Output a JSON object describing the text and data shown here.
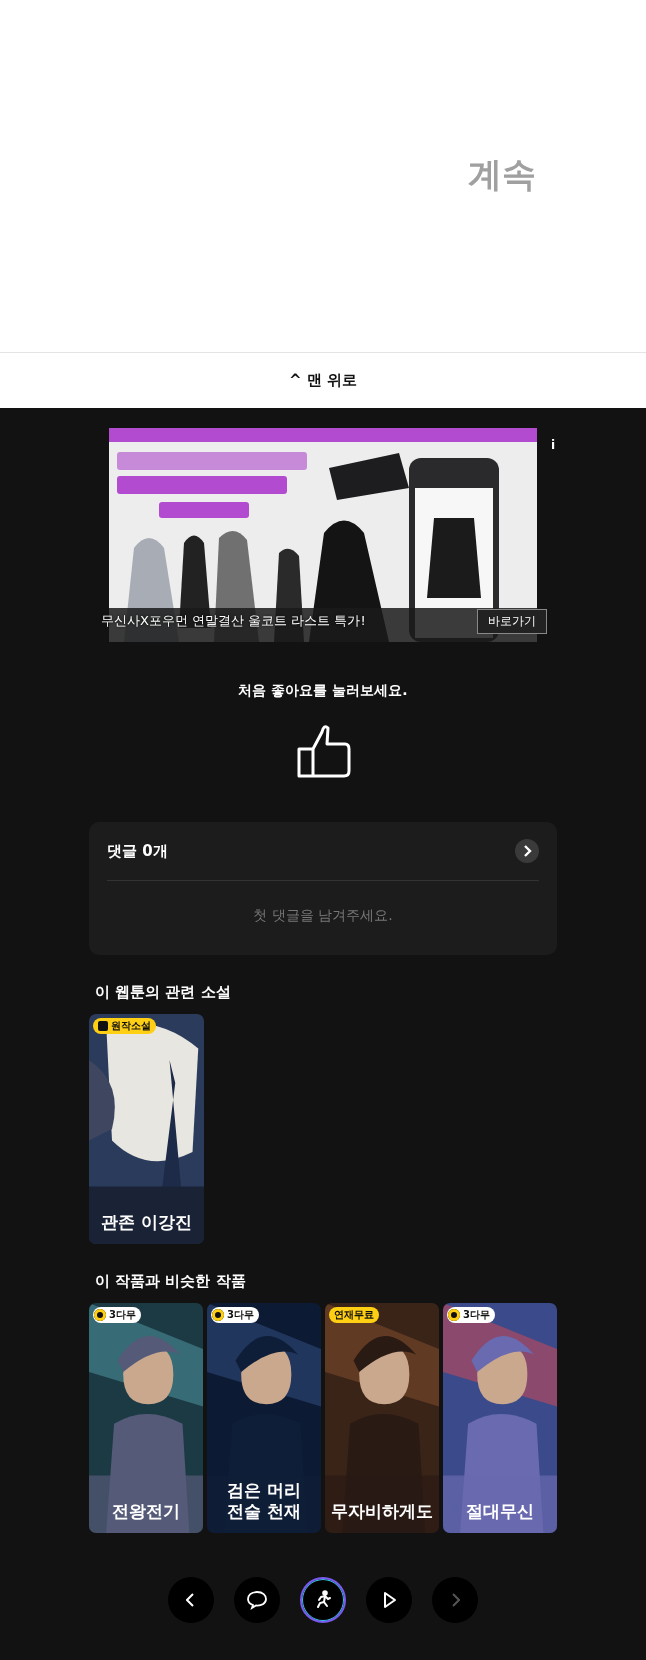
{
  "continue_label": "계속",
  "back_to_top": {
    "icon": "^",
    "label": "맨 위로"
  },
  "ad": {
    "caption": "무신사X포우먼 연말결산 울코트 라스트 특가!",
    "button": "바로가기",
    "info": "i"
  },
  "like": {
    "prompt": "처음 좋아요를 눌러보세요.",
    "liked": false
  },
  "comments": {
    "title": "댓글 0개",
    "empty": "첫 댓글을 남겨주세요."
  },
  "related_novels": {
    "heading": "이 웹툰의 관련 소설",
    "items": [
      {
        "title": "관존 이강진",
        "badge": {
          "kind": "novel",
          "label": "원작소설"
        }
      }
    ]
  },
  "similar": {
    "heading": "이 작품과 비슷한 작품",
    "items": [
      {
        "title": "전왕전기",
        "badge": {
          "kind": "wait",
          "label": "3다무"
        }
      },
      {
        "title": "검은 머리 전술 천재",
        "badge": {
          "kind": "wait",
          "label": "3다무"
        }
      },
      {
        "title": "무자비하게도",
        "badge": {
          "kind": "free",
          "label": "연재무료"
        }
      },
      {
        "title": "절대무신",
        "badge": {
          "kind": "wait",
          "label": "3다무"
        }
      }
    ]
  },
  "nav": [
    {
      "kind": "prev",
      "selected": false
    },
    {
      "kind": "comment",
      "selected": false
    },
    {
      "kind": "run",
      "selected": true
    },
    {
      "kind": "play",
      "selected": false
    },
    {
      "kind": "next",
      "selected": false
    }
  ]
}
